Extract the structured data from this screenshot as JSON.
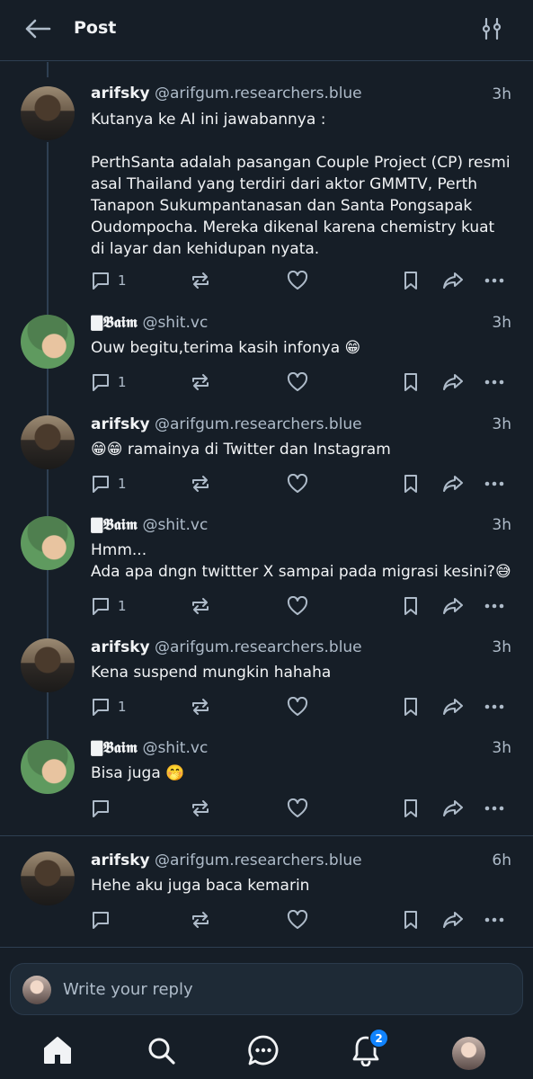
{
  "header": {
    "title": "Post",
    "back_icon": "arrow-left-icon",
    "filter_icon": "sliders-icon"
  },
  "posts": [
    {
      "name": "arifsky",
      "handle": "@arifgum.researchers.blue",
      "time": "3h",
      "text": "Kutanya ke AI ini jawabannya :\n\nPerthSanta adalah pasangan Couple Project (CP) resmi asal Thailand yang terdiri dari aktor GMMTV, Perth Tanapon Sukumpantanasan dan Santa Pongsapak Oudompocha. Mereka dikenal karena chemistry kuat di layar dan kehidupan nyata.",
      "replies": "1"
    },
    {
      "name": "🀫𝕭𝖆𝖎𝖒",
      "handle": "@shit.vc",
      "time": "3h",
      "text": "Ouw begitu,terima kasih infonya 😁",
      "replies": "1"
    },
    {
      "name": "arifsky",
      "handle": "@arifgum.researchers.blue",
      "time": "3h",
      "text": "😁😁 ramainya di Twitter dan Instagram",
      "replies": "1"
    },
    {
      "name": "🀫𝕭𝖆𝖎𝖒",
      "handle": "@shit.vc",
      "time": "3h",
      "text": "Hmm...\nAda apa dngn twittter X sampai pada migrasi kesini?😅",
      "replies": "1"
    },
    {
      "name": "arifsky",
      "handle": "@arifgum.researchers.blue",
      "time": "3h",
      "text": "Kena suspend mungkin hahaha",
      "replies": "1"
    },
    {
      "name": "🀫𝕭𝖆𝖎𝖒",
      "handle": "@shit.vc",
      "time": "3h",
      "text": "Bisa juga 🤭",
      "replies": ""
    },
    {
      "name": "arifsky",
      "handle": "@arifgum.researchers.blue",
      "time": "6h",
      "text": "Hehe aku juga baca kemarin",
      "replies": ""
    }
  ],
  "composer": {
    "placeholder": "Write your reply"
  },
  "tabbar": {
    "items": [
      "home-icon",
      "search-icon",
      "chat-icon",
      "bell-icon",
      "profile-avatar"
    ],
    "notification_count": "2"
  },
  "colors": {
    "background": "#161e27",
    "text": "#f1f3f5",
    "muted": "#aebbc9",
    "accent": "#1083fe"
  }
}
